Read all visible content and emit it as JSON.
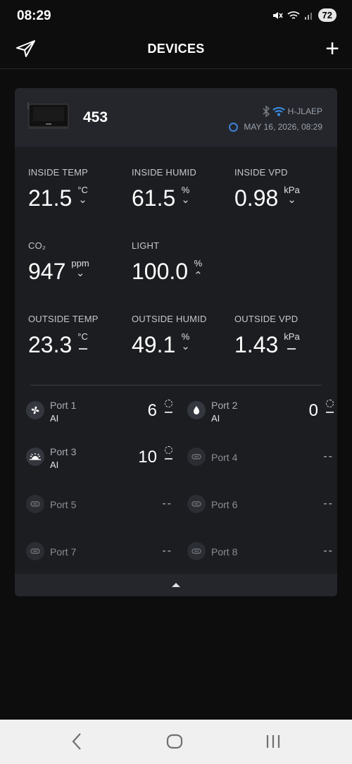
{
  "status": {
    "time": "08:29",
    "battery": "72"
  },
  "header": {
    "title": "DEVICES",
    "logo_icon": "paper-plane-logo",
    "add_label": "+"
  },
  "device": {
    "name": "453",
    "network": "H-JLAEP",
    "timestamp": "MAY 16, 2026, 08:29",
    "icons": [
      "bluetooth-icon",
      "wifi-icon"
    ]
  },
  "metrics": [
    {
      "label": "INSIDE TEMP",
      "value": "21.5",
      "unit": "°C",
      "trend": "down"
    },
    {
      "label": "INSIDE HUMID",
      "value": "61.5",
      "unit": "%",
      "trend": "down"
    },
    {
      "label": "INSIDE VPD",
      "value": "0.98",
      "unit": "kPa",
      "trend": "down"
    },
    {
      "label": "CO₂",
      "value": "947",
      "unit": "ppm",
      "trend": "down"
    },
    {
      "label": "LIGHT",
      "value": "100.0",
      "unit": "%",
      "trend": "up"
    },
    {
      "label": "OUTSIDE TEMP",
      "value": "23.3",
      "unit": "°C",
      "trend": "flat"
    },
    {
      "label": "OUTSIDE HUMID",
      "value": "49.1",
      "unit": "%",
      "trend": "down"
    },
    {
      "label": "OUTSIDE VPD",
      "value": "1.43",
      "unit": "kPa",
      "trend": "flat"
    }
  ],
  "ports": [
    {
      "name": "Port 1",
      "mode": "AI",
      "level": "6",
      "icon": "fan-icon",
      "active": true
    },
    {
      "name": "Port 2",
      "mode": "AI",
      "level": "0",
      "icon": "water-drop-icon",
      "active": true
    },
    {
      "name": "Port 3",
      "mode": "AI",
      "level": "10",
      "icon": "grow-light-icon",
      "active": true
    },
    {
      "name": "Port 4",
      "mode": "",
      "level": "--",
      "icon": "plug-icon",
      "active": false
    },
    {
      "name": "Port 5",
      "mode": "",
      "level": "--",
      "icon": "plug-icon",
      "active": false
    },
    {
      "name": "Port 6",
      "mode": "",
      "level": "--",
      "icon": "plug-icon",
      "active": false
    },
    {
      "name": "Port 7",
      "mode": "",
      "level": "--",
      "icon": "plug-icon",
      "active": false
    },
    {
      "name": "Port 8",
      "mode": "",
      "level": "--",
      "icon": "plug-icon",
      "active": false
    }
  ],
  "nav": {
    "icons": [
      "back-icon",
      "home-icon",
      "recents-icon"
    ]
  }
}
